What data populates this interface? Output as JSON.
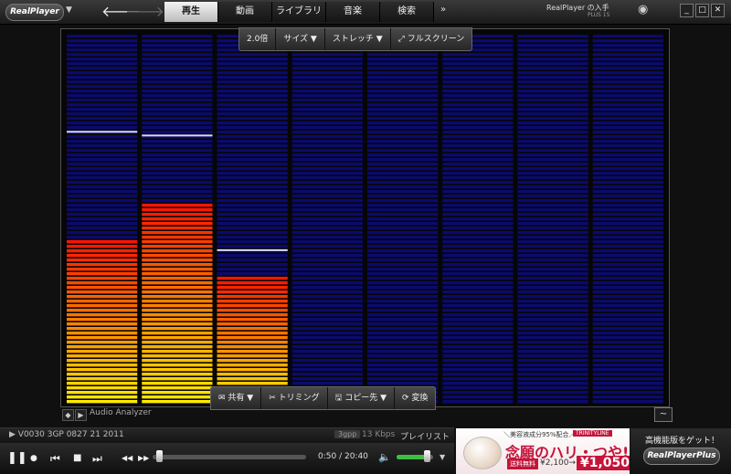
{
  "app": {
    "logo": "RealPlayer",
    "caret": "▼"
  },
  "nav": {
    "back": "🡐",
    "forward": "🡒"
  },
  "tabs": [
    {
      "label": "再生",
      "active": true
    },
    {
      "label": "動画",
      "active": false
    },
    {
      "label": "ライブラリ",
      "active": false
    },
    {
      "label": "音楽",
      "active": false
    },
    {
      "label": "検索",
      "active": false
    }
  ],
  "tabs_more": "»",
  "promo": {
    "title": "RealPlayer の入手",
    "sub": "PLUS 15"
  },
  "window": {
    "eye": "◉",
    "minimize": "_",
    "maximize": "□",
    "close": "✕"
  },
  "video_toolbar": {
    "zoom": "2.0倍",
    "size": "サイズ ▼",
    "stretch": "ストレッチ ▼",
    "fullscreen_icon": "⤢",
    "fullscreen": "フルスクリーン"
  },
  "action_toolbar": {
    "share_icon": "✉",
    "share": "共有 ▼",
    "trim_icon": "✂",
    "trim": "トリミング",
    "copy_icon": "🖫",
    "copy": "コピー先 ▼",
    "convert_icon": "⟳",
    "convert": "変換"
  },
  "visualizer": {
    "label": "Audio Analyzer",
    "bg_segment": "#0a0a6e",
    "bars": [
      {
        "level": 0.44,
        "peak": 0.74
      },
      {
        "level": 0.54,
        "peak": 0.73
      },
      {
        "level": 0.34,
        "peak": 0.42
      },
      {
        "level": 0,
        "peak": 0
      },
      {
        "level": 0,
        "peak": 0
      },
      {
        "level": 0,
        "peak": 0
      },
      {
        "level": 0,
        "peak": 0
      },
      {
        "level": 0,
        "peak": 0
      }
    ],
    "corner_icon": "~"
  },
  "status": {
    "play_icon": "▶",
    "filename": "V0030 3GP 0827 21 2011",
    "format": "3gpp",
    "kbps": "13 Kbps",
    "playlist": "プレイリスト"
  },
  "controls": {
    "pause": "❚❚",
    "stop_dot": "●",
    "prev": "⏮",
    "stop": "■",
    "next": "⏭",
    "rewind": "◀◀",
    "ffwd": "▶▶",
    "time": "0:50 / 20:40",
    "seek_progress": 0.04,
    "volume_icon": "🔈",
    "volume": 0.82,
    "volume_caret": "▼"
  },
  "ad": {
    "top": "＼美容液成分95%配合／",
    "brand": "TRINITYLINE",
    "headline": "念願のハリ・つや!",
    "badge": "送料無料",
    "old_price": "¥2,100→",
    "price": "¥1,050"
  },
  "upsell": {
    "text": "高機能版をゲット！",
    "logo": "RealPlayerPlus"
  }
}
